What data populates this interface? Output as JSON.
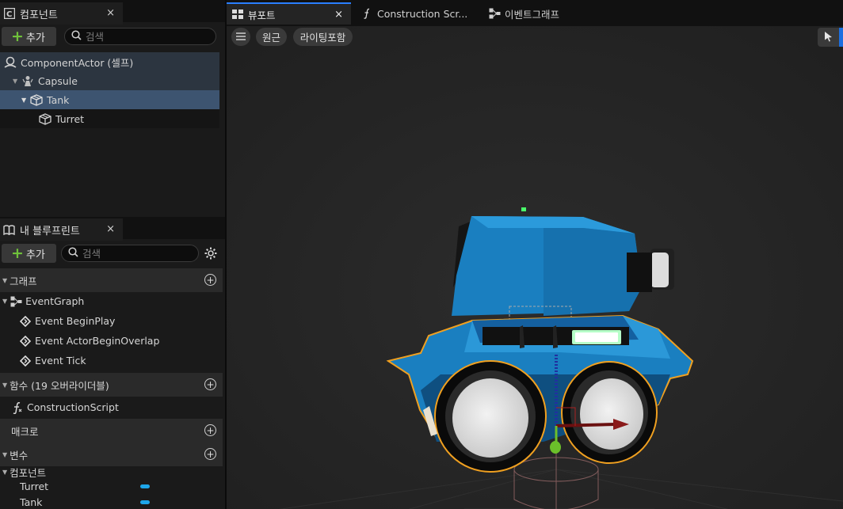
{
  "components_panel": {
    "tab_label": "컴포넌트",
    "close": "×",
    "add_label": "추가",
    "search_placeholder": "검색",
    "tree": [
      {
        "label": "ComponentActor (셀프)",
        "icon": "actor-icon"
      },
      {
        "label": "Capsule",
        "icon": "capsule-icon"
      },
      {
        "label": "Tank",
        "icon": "static-mesh-icon"
      },
      {
        "label": "Turret",
        "icon": "static-mesh-icon"
      }
    ]
  },
  "blueprint_panel": {
    "tab_label": "내 블루프린트",
    "close": "×",
    "add_label": "추가",
    "search_placeholder": "검색",
    "sections": {
      "graph": "그래프",
      "event_graph": "EventGraph",
      "events": [
        "Event BeginPlay",
        "Event ActorBeginOverlap",
        "Event Tick"
      ],
      "functions": "함수 (19 오버라이더블)",
      "construction_script": "ConstructionScript",
      "macros": "매크로",
      "variables": "변수",
      "components_category": "컴포넌트",
      "variable_items": [
        "Turret",
        "Tank"
      ]
    },
    "variable_color": "#1ea6ea"
  },
  "main_tabs": [
    {
      "label": "뷰포트",
      "icon": "viewport-icon",
      "close": "×"
    },
    {
      "label": "Construction Scr...",
      "icon": "function-icon"
    },
    {
      "label": "이벤트그래프",
      "icon": "graph-icon"
    }
  ],
  "viewport": {
    "perspective_label": "원근",
    "lighting_label": "라이팅포함"
  },
  "colors": {
    "accent": "#2a7fff",
    "tank_body": "#1a7fc0",
    "selection_outline": "#f0a020",
    "add_green": "#6fc13b"
  }
}
